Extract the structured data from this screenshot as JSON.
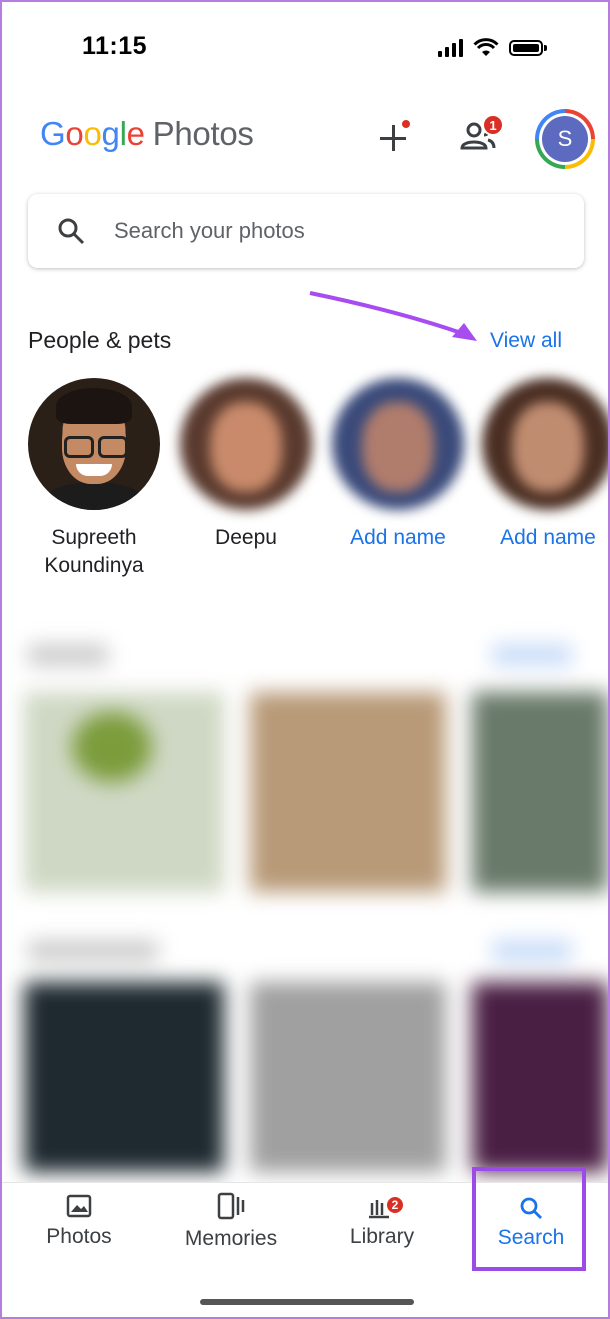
{
  "status_bar": {
    "time": "11:15"
  },
  "header": {
    "logo_google": [
      "G",
      "o",
      "o",
      "g",
      "l",
      "e"
    ],
    "logo_photos": "Photos",
    "sharing_badge": "1",
    "avatar_initial": "S"
  },
  "search": {
    "placeholder": "Search your photos"
  },
  "people": {
    "title": "People & pets",
    "view_all": "View all",
    "items": [
      {
        "name": "Supreeth Koundinya"
      },
      {
        "name": "Deepu"
      },
      {
        "name": "Add name"
      },
      {
        "name": "Add name"
      }
    ]
  },
  "nav": {
    "photos": "Photos",
    "memories": "Memories",
    "library": "Library",
    "library_badge": "2",
    "search": "Search"
  },
  "colors": {
    "accent": "#1a73e8",
    "badge": "#d93025",
    "highlight": "#9b4be8",
    "avatar_bg": "#5c6bc0"
  }
}
